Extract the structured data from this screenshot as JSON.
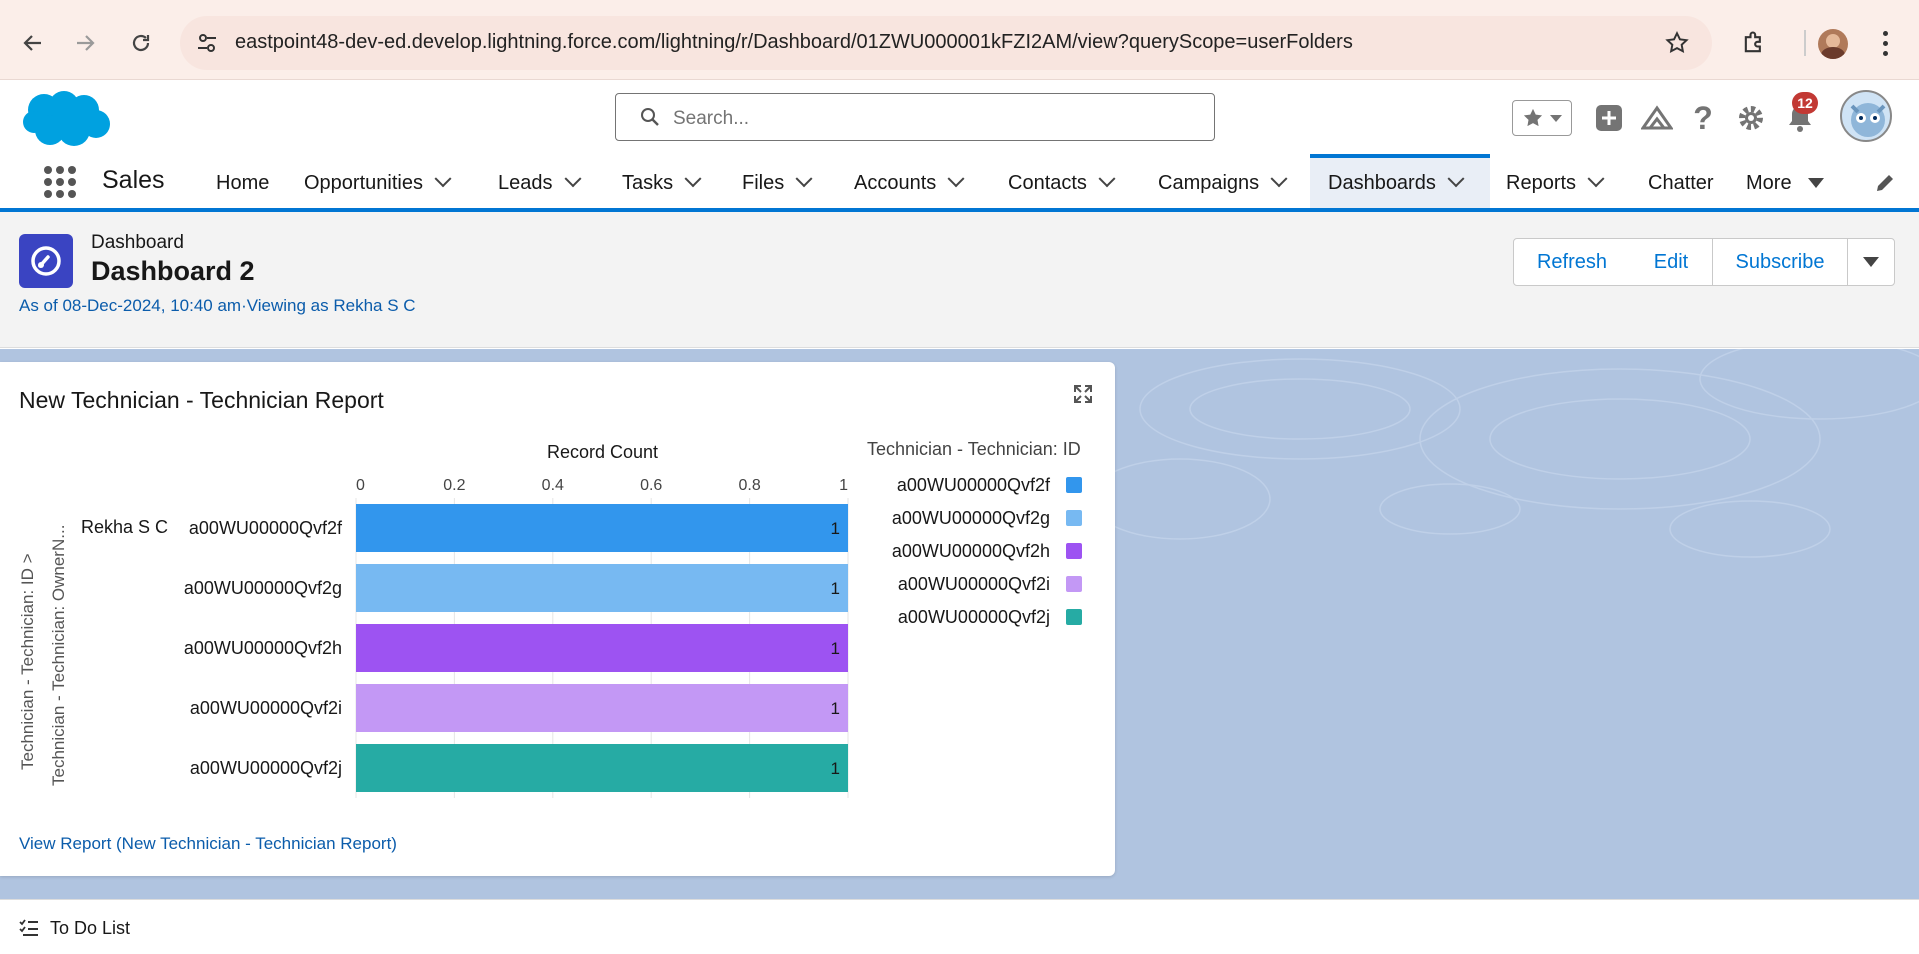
{
  "browser": {
    "url": "eastpoint48-dev-ed.develop.lightning.force.com/lightning/r/Dashboard/01ZWU000001kFZI2AM/view?queryScope=userFolders"
  },
  "header": {
    "search_placeholder": "Search...",
    "notification_count": "12"
  },
  "nav": {
    "app_name": "Sales",
    "items": [
      {
        "label": "Home",
        "chevron": false
      },
      {
        "label": "Opportunities",
        "chevron": true
      },
      {
        "label": "Leads",
        "chevron": true
      },
      {
        "label": "Tasks",
        "chevron": true
      },
      {
        "label": "Files",
        "chevron": true
      },
      {
        "label": "Accounts",
        "chevron": true
      },
      {
        "label": "Contacts",
        "chevron": true
      },
      {
        "label": "Campaigns",
        "chevron": true
      },
      {
        "label": "Dashboards",
        "chevron": true,
        "active": true
      },
      {
        "label": "Reports",
        "chevron": true
      },
      {
        "label": "Chatter",
        "chevron": false
      },
      {
        "label": "More",
        "chevron": false
      }
    ]
  },
  "dashboard": {
    "object_label": "Dashboard",
    "title": "Dashboard 2",
    "subtitle": "As of 08-Dec-2024, 10:40 am·Viewing as Rekha S C",
    "buttons": {
      "refresh": "Refresh",
      "edit": "Edit",
      "subscribe": "Subscribe"
    }
  },
  "card": {
    "title": "New Technician - Technician Report",
    "view_report_link": "View Report (New Technician - Technician Report)"
  },
  "chart_data": {
    "type": "bar",
    "orientation": "horizontal",
    "xlabel": "Record Count",
    "ylabel_outer": "Technician - Technician: ID >",
    "ylabel_inner": "Technician - Technician: OwnerN...",
    "group_label": "Rekha S C",
    "xlim": [
      0,
      1
    ],
    "xticks": [
      "0",
      "0.2",
      "0.4",
      "0.6",
      "0.8",
      "1"
    ],
    "xtick_values": [
      0,
      0.2,
      0.4,
      0.6,
      0.8,
      1
    ],
    "categories": [
      "a00WU00000Qvf2f",
      "a00WU00000Qvf2g",
      "a00WU00000Qvf2h",
      "a00WU00000Qvf2i",
      "a00WU00000Qvf2j"
    ],
    "values": [
      1,
      1,
      1,
      1,
      1
    ],
    "data_labels": [
      "1",
      "1",
      "1",
      "1",
      "1"
    ],
    "colors": [
      "#3296ed",
      "#77b9f2",
      "#9d53f2",
      "#c398f5",
      "#26aba4"
    ],
    "legend_title": "Technician - Technician: ID",
    "legend_placement": "right",
    "grid": true
  },
  "footer": {
    "todo_label": "To Do List"
  },
  "colors": {
    "brand_blue": "#0176d3",
    "salesforce_cloud": "#00a1e0",
    "dashboard_icon": "#3a44c2",
    "notification_red": "#c23934"
  }
}
